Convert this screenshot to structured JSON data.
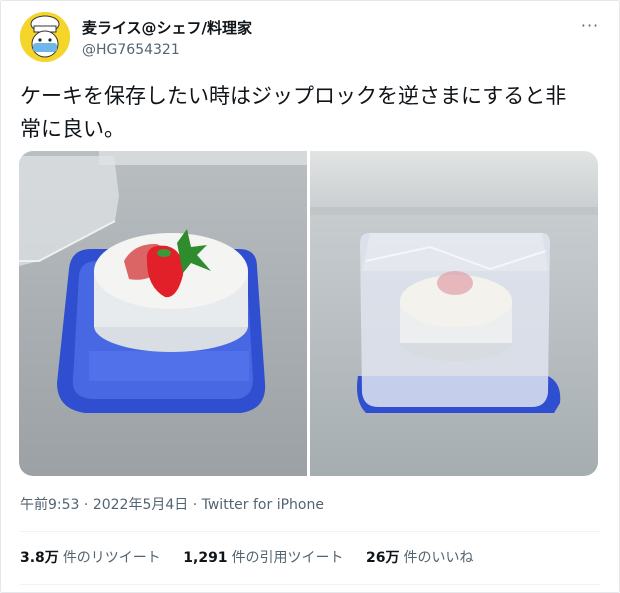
{
  "tweet": {
    "author_name": "麦ライス@シェフ/料理家",
    "handle": "@HG7654321",
    "more_label": "···",
    "text": "ケーキを保存したい時はジップロックを逆さまにすると非\n常に良い。",
    "time": "午前9:53",
    "date": "2022年5月4日",
    "source": "Twitter for iPhone",
    "separator": "·"
  },
  "stats": [
    {
      "count": "3.8万",
      "label": "件のリツイート"
    },
    {
      "count": "1,291",
      "label": "件の引用ツイート"
    },
    {
      "count": "26万",
      "label": "件のいいね"
    }
  ],
  "colors": {
    "avatar_bg": "#f6d52a",
    "tray_blue": "#3b57d6",
    "muted_text": "#536471"
  },
  "media": [
    {
      "name": "photo-cake-uncovered",
      "icon": "photo"
    },
    {
      "name": "photo-cake-covered",
      "icon": "photo"
    }
  ]
}
